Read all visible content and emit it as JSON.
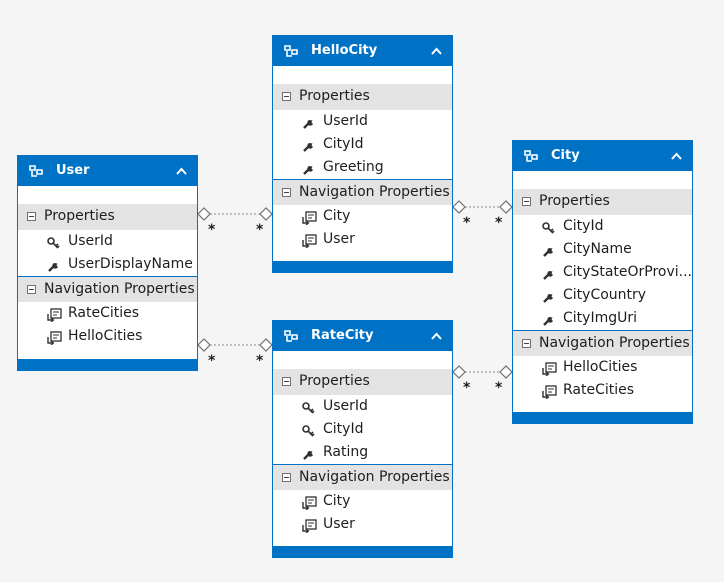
{
  "colors": {
    "entity_header": "#0072c6",
    "section_bg": "#e3e3e3",
    "canvas": "#f5f5f5",
    "connector": "#808080"
  },
  "entities": {
    "user": {
      "title": "User",
      "properties_label": "Properties",
      "properties": [
        "UserId",
        "UserDisplayName"
      ],
      "property_icons": [
        "key-icon",
        "wrench-icon"
      ],
      "navigation_label": "Navigation Properties",
      "navigation": [
        "RateCities",
        "HelloCities"
      ]
    },
    "hellocity": {
      "title": "HelloCity",
      "properties_label": "Properties",
      "properties": [
        "UserId",
        "CityId",
        "Greeting"
      ],
      "property_icons": [
        "wrench-icon",
        "wrench-icon",
        "wrench-icon"
      ],
      "navigation_label": "Navigation Properties",
      "navigation": [
        "City",
        "User"
      ]
    },
    "ratecity": {
      "title": "RateCity",
      "properties_label": "Properties",
      "properties": [
        "UserId",
        "CityId",
        "Rating"
      ],
      "property_icons": [
        "key-icon",
        "key-icon",
        "wrench-icon"
      ],
      "navigation_label": "Navigation Properties",
      "navigation": [
        "City",
        "User"
      ]
    },
    "city": {
      "title": "City",
      "properties_label": "Properties",
      "properties": [
        "CityId",
        "CityName",
        "CityStateOrProvi...",
        "CityCountry",
        "CityImgUri"
      ],
      "property_icons": [
        "key-icon",
        "wrench-icon",
        "wrench-icon",
        "wrench-icon",
        "wrench-icon"
      ],
      "navigation_label": "Navigation Properties",
      "navigation": [
        "HelloCities",
        "RateCities"
      ]
    }
  },
  "associations": [
    {
      "from": "User",
      "to": "HelloCity",
      "from_multiplicity": "*",
      "to_multiplicity": "*"
    },
    {
      "from": "User",
      "to": "RateCity",
      "from_multiplicity": "*",
      "to_multiplicity": "*"
    },
    {
      "from": "HelloCity",
      "to": "City",
      "from_multiplicity": "*",
      "to_multiplicity": "*"
    },
    {
      "from": "RateCity",
      "to": "City",
      "from_multiplicity": "*",
      "to_multiplicity": "*"
    }
  ]
}
